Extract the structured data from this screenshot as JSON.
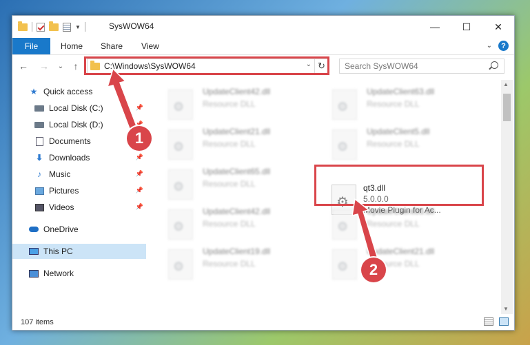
{
  "window": {
    "title": "SysWOW64",
    "controls": {
      "minimize": "—",
      "maximize": "☐",
      "close": "✕"
    }
  },
  "ribbon": {
    "file_tab": "File",
    "tabs": [
      "Home",
      "Share",
      "View"
    ],
    "help": "?"
  },
  "navigation": {
    "back": "←",
    "forward": "→",
    "recent": "⌄",
    "up": "↑",
    "address": "C:\\Windows\\SysWOW64",
    "refresh": "↻",
    "search_placeholder": "Search SysWOW64"
  },
  "sidebar": {
    "items": [
      {
        "label": "Quick access",
        "icon": "star-icon"
      },
      {
        "label": "Local Disk (C:)",
        "icon": "drive-icon",
        "pinned": true
      },
      {
        "label": "Local Disk (D:)",
        "icon": "drive-icon",
        "pinned": true
      },
      {
        "label": "Documents",
        "icon": "document-icon",
        "pinned": true
      },
      {
        "label": "Downloads",
        "icon": "download-icon",
        "pinned": true
      },
      {
        "label": "Music",
        "icon": "music-icon",
        "pinned": true
      },
      {
        "label": "Pictures",
        "icon": "pictures-icon",
        "pinned": true
      },
      {
        "label": "Videos",
        "icon": "videos-icon",
        "pinned": true
      },
      {
        "label": "OneDrive",
        "icon": "onedrive-icon"
      },
      {
        "label": "This PC",
        "icon": "pc-icon",
        "selected": true
      },
      {
        "label": "Network",
        "icon": "network-icon"
      }
    ]
  },
  "files": {
    "blurred": [
      {
        "name": "UpdateClient42.dll",
        "type": "Resource DLL"
      },
      {
        "name": "UpdateClient63.dll",
        "type": "Resource DLL"
      },
      {
        "name": "UpdateClient21.dll",
        "type": "Resource DLL"
      },
      {
        "name": "UpdateClient5.dll",
        "type": "Resource DLL"
      },
      {
        "name": "UpdateClient65.dll",
        "type": "Resource DLL"
      },
      {
        "name": "UpdateClient42.dll",
        "type": "Resource DLL"
      },
      {
        "name": "UpdateClient63.dll",
        "type": "Resource DLL"
      },
      {
        "name": "UpdateClient19.dll",
        "type": "Resource DLL"
      },
      {
        "name": "UpdateClient21.dll",
        "type": "Resource DLL"
      }
    ],
    "selected": {
      "name": "qt3.dll",
      "version": "5.0.0.0",
      "description": "Movie Plugin for Ac..."
    }
  },
  "status": {
    "count": "107 items"
  },
  "annotations": {
    "badge1": "1",
    "badge2": "2",
    "accent": "#d9454a"
  }
}
